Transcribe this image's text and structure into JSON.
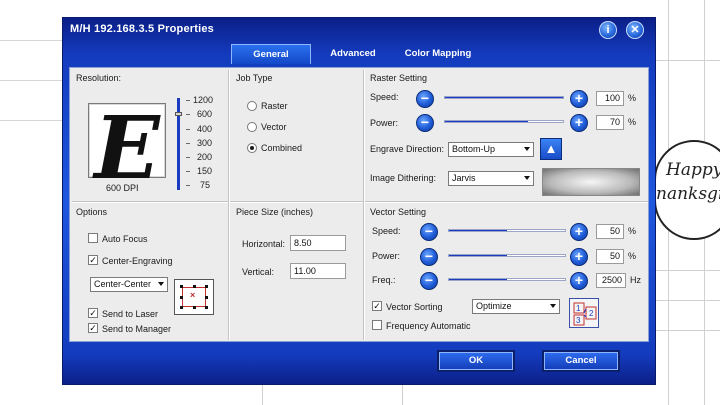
{
  "window": {
    "title": "M/H 192.168.3.5 Properties",
    "info_glyph": "i",
    "close_glyph": "✕"
  },
  "tabs": [
    {
      "label": "General",
      "active": true
    },
    {
      "label": "Advanced",
      "active": false
    },
    {
      "label": "Color Mapping",
      "active": false
    }
  ],
  "resolution": {
    "title": "Resolution:",
    "preview_glyph": "E",
    "current": "600 DPI",
    "scale": [
      "1200",
      "600",
      "400",
      "300",
      "200",
      "150",
      "75"
    ]
  },
  "job_type": {
    "title": "Job Type",
    "options": [
      "Raster",
      "Vector",
      "Combined"
    ],
    "selected": "Combined"
  },
  "raster": {
    "title": "Raster Setting",
    "speed_label": "Speed:",
    "speed_value": "100",
    "speed_unit": "%",
    "power_label": "Power:",
    "power_value": "70",
    "power_unit": "%",
    "engrave_label": "Engrave Direction:",
    "engrave_value": "Bottom-Up",
    "dither_label": "Image Dithering:",
    "dither_value": "Jarvis",
    "up_glyph": "▲"
  },
  "options": {
    "title": "Options",
    "auto_focus": "Auto Focus",
    "auto_focus_checked": false,
    "center_engraving": "Center-Engraving",
    "center_engraving_checked": true,
    "center_mode": "Center-Center",
    "send_to_laser": "Send to Laser",
    "send_to_laser_checked": true,
    "send_to_manager": "Send to Manager",
    "send_to_manager_checked": true,
    "anchor_mark": "×"
  },
  "piece": {
    "title": "Piece Size (inches)",
    "horizontal_label": "Horizontal:",
    "horizontal_value": "8.50",
    "vertical_label": "Vertical:",
    "vertical_value": "11.00"
  },
  "vector": {
    "title": "Vector Setting",
    "speed_label": "Speed:",
    "speed_value": "50",
    "speed_unit": "%",
    "power_label": "Power:",
    "power_value": "50",
    "power_unit": "%",
    "freq_label": "Freq.:",
    "freq_value": "2500",
    "freq_unit": "Hz",
    "sorting_label": "Vector Sorting",
    "sorting_checked": true,
    "sorting_value": "Optimize",
    "freq_auto_label": "Frequency Automatic",
    "freq_auto_checked": false
  },
  "buttons": {
    "ok": "OK",
    "cancel": "Cancel",
    "minus": "−",
    "plus": "+"
  },
  "background": {
    "card_line1": "Happy",
    "card_line2": "nanksgiv"
  },
  "colors": {
    "title_bar": "#143bbd",
    "panel": "#ececec",
    "slider_fill": "#1a3cc0",
    "accent_red": "#c53030"
  },
  "sliders": {
    "raster_speed": 1.0,
    "raster_power": 0.7,
    "vector_speed": 0.5,
    "vector_power": 0.5,
    "vector_freq": 0.5
  }
}
